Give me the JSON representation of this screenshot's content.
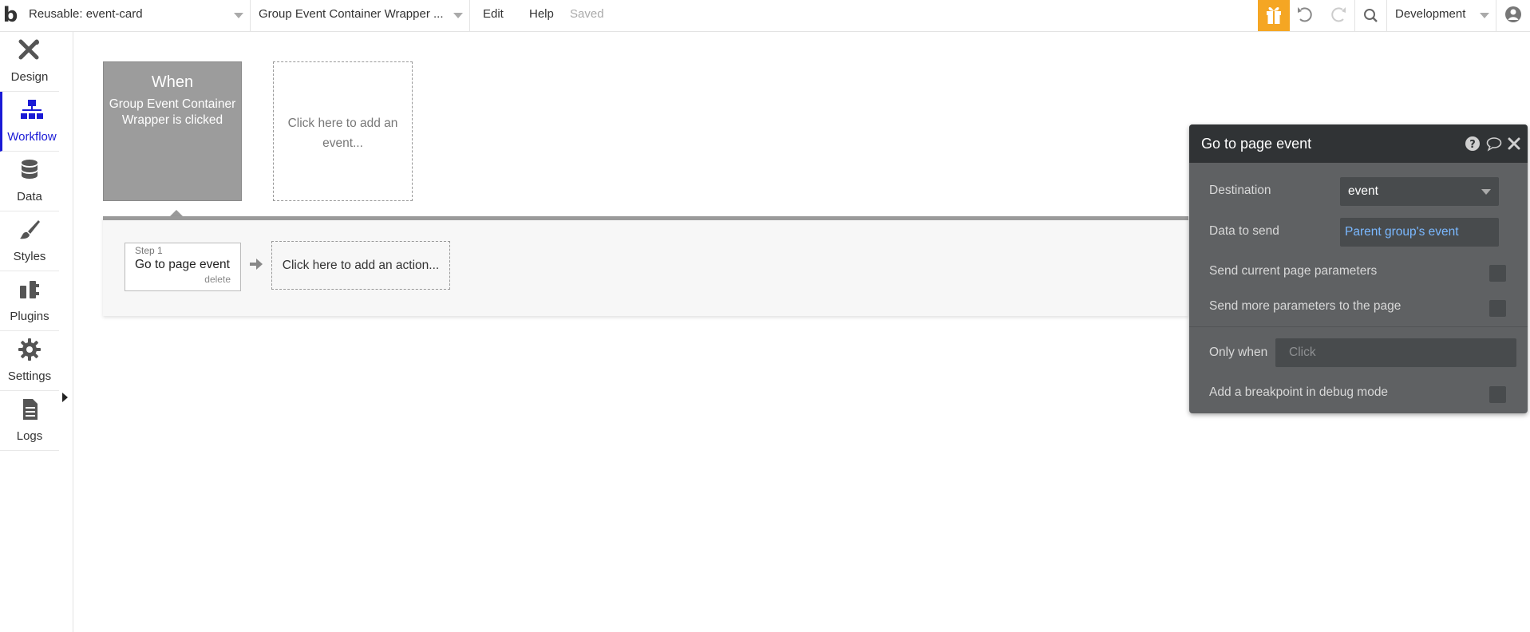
{
  "topbar": {
    "logo": "b",
    "page_selector": "Reusable: event-card",
    "element_selector": "Group Event Container Wrapper ...",
    "menu_edit": "Edit",
    "menu_help": "Help",
    "status": "Saved",
    "environment": "Development",
    "accent_color": "#f5a623"
  },
  "sidebar": {
    "items": [
      {
        "label": "Design",
        "icon": "design-icon"
      },
      {
        "label": "Workflow",
        "icon": "workflow-icon"
      },
      {
        "label": "Data",
        "icon": "database-icon"
      },
      {
        "label": "Styles",
        "icon": "brush-icon"
      },
      {
        "label": "Plugins",
        "icon": "plugins-icon"
      },
      {
        "label": "Settings",
        "icon": "gear-icon"
      },
      {
        "label": "Logs",
        "icon": "document-icon"
      }
    ],
    "active": "Workflow",
    "active_color": "#1a1ad6"
  },
  "workflow": {
    "event_heading": "When",
    "event_description": "Group Event Container Wrapper is clicked",
    "add_event_text": "Click here to add an event...",
    "step_number": "Step 1",
    "step_title": "Go to page event",
    "step_delete": "delete",
    "add_action_text": "Click here to add an action..."
  },
  "panel": {
    "title": "Go to page event",
    "destination_label": "Destination",
    "destination_value": "event",
    "data_to_send_label": "Data to send",
    "data_to_send_value": "Parent group's event",
    "send_current_label": "Send current page parameters",
    "send_more_label": "Send more parameters to the page",
    "only_when_label": "Only when",
    "only_when_placeholder": "Click",
    "breakpoint_label": "Add a breakpoint in debug mode"
  }
}
